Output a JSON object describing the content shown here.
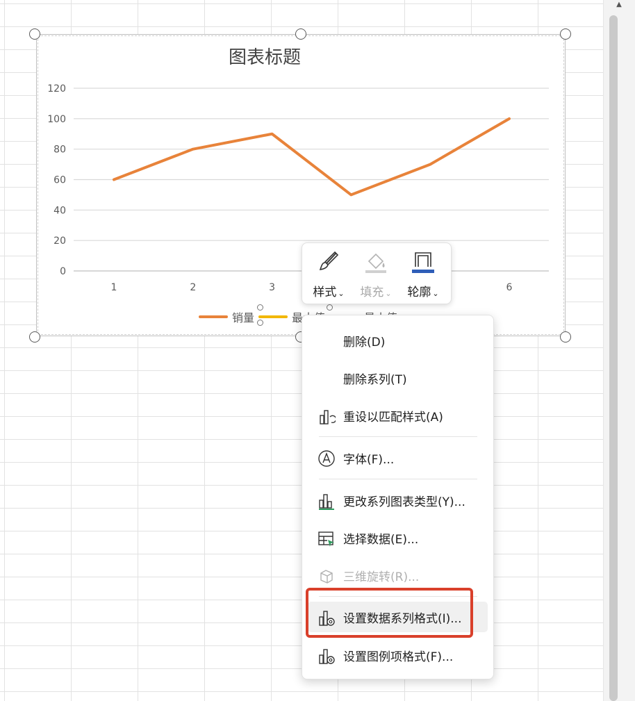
{
  "chart_data": {
    "type": "line",
    "title": "图表标题",
    "x": [
      1,
      2,
      3,
      4,
      5,
      6
    ],
    "x_tick_labels": [
      "1",
      "2",
      "3",
      "6"
    ],
    "series": [
      {
        "name": "销量",
        "values": [
          60,
          80,
          90,
          50,
          70,
          100
        ],
        "color": "#e8833a"
      }
    ],
    "y_ticks": [
      0,
      20,
      40,
      60,
      80,
      100,
      120
    ],
    "ylim": [
      0,
      120
    ],
    "grid": true,
    "legend": {
      "placement": "bottom",
      "entries": [
        {
          "name": "销量",
          "color": "#e8833a"
        },
        {
          "name": "最大值",
          "color": "#f2b705"
        },
        {
          "name": "最小值",
          "color": "#6aa84f"
        }
      ]
    }
  },
  "mini_toolbar": {
    "style": {
      "label": "样式",
      "icon": "brush-icon"
    },
    "fill": {
      "label": "填充",
      "icon": "paint-bucket-icon",
      "disabled": true
    },
    "outline": {
      "label": "轮廓",
      "icon": "outline-icon",
      "color": "#2f5eb8"
    }
  },
  "context_menu": {
    "items": [
      {
        "label": "删除(D)",
        "icon": ""
      },
      {
        "label": "删除系列(T)",
        "icon": ""
      },
      {
        "label": "重设以匹配样式(A)",
        "icon": "reset-style-icon"
      },
      {
        "label": "字体(F)...",
        "icon": "font-icon"
      },
      {
        "label": "更改系列图表类型(Y)...",
        "icon": "chart-type-icon"
      },
      {
        "label": "选择数据(E)...",
        "icon": "select-data-icon"
      },
      {
        "label": "三维旋转(R)...",
        "icon": "3d-rotate-icon",
        "disabled": true
      },
      {
        "label": "设置数据系列格式(I)...",
        "icon": "format-series-icon",
        "hover": true
      },
      {
        "label": "设置图例项格式(F)...",
        "icon": "format-legend-icon"
      }
    ]
  },
  "colors": {
    "highlight": "#d9402b",
    "gridline": "#d9d9d9",
    "axis_text": "#595959"
  }
}
